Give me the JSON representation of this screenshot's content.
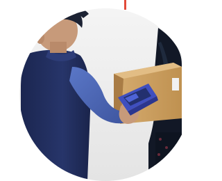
{
  "image": {
    "subject": "delivery-handoff-illustration",
    "colors": {
      "background": "#ffffff",
      "circle_bg": "#ededed",
      "accent_line": "#e24a3a",
      "courier_vest": "#1f2c55",
      "courier_shirt": "#4f69b8",
      "courier_hair": "#1c2233",
      "skin": "#c79a7a",
      "box": "#c79b5e",
      "box_dark": "#a97c45",
      "scanner_body": "#3f4fbf",
      "scanner_screen": "#23306f",
      "recipient_jacket": "#111827",
      "recipient_shirt": "#6a2a3a"
    }
  }
}
